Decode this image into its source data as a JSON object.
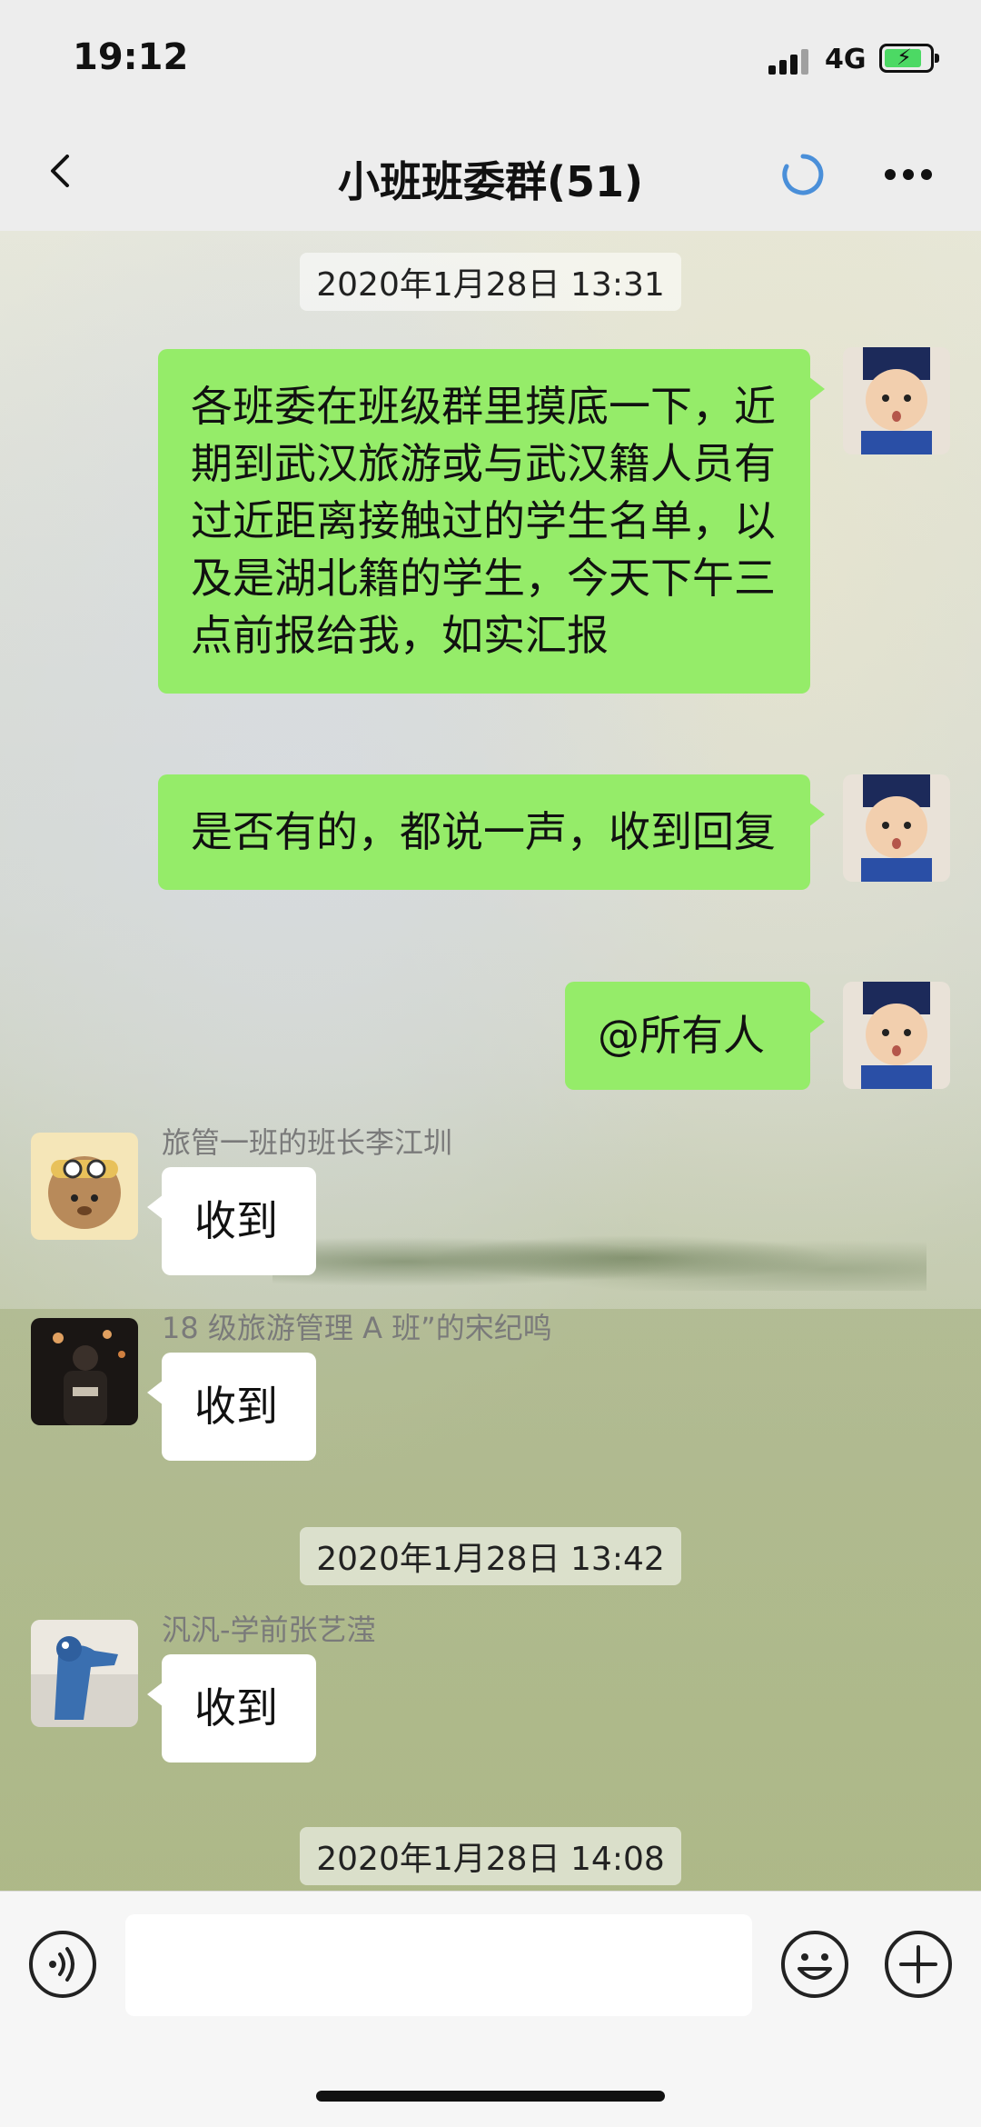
{
  "status_bar": {
    "time": "19:12",
    "network": "4G"
  },
  "nav": {
    "title": "小班班委群(51)"
  },
  "timestamps": [
    "2020年1月28日 13:31",
    "2020年1月28日 13:42",
    "2020年1月28日 14:08"
  ],
  "messages": [
    {
      "side": "out",
      "text": "各班委在班级群里摸底一下，近期到武汉旅游或与武汉籍人员有过近距离接触过的学生名单，以及是湖北籍的学生，今天下午三点前报给我，如实汇报"
    },
    {
      "side": "out",
      "text": "是否有的，都说一声，收到回复"
    },
    {
      "side": "out",
      "text": "@所有人"
    },
    {
      "side": "in",
      "sender": "旅管一班的班长李江圳",
      "text": "收到"
    },
    {
      "side": "in",
      "sender": "18 级旅游管理 A 班”的宋纪鸣",
      "text": "收到"
    },
    {
      "side": "in",
      "sender": "汎汎-学前张艺滢",
      "text": "收到"
    }
  ],
  "input": {
    "placeholder": ""
  },
  "icons": {
    "back": "back-chevron-icon",
    "sync": "sync-ring-icon",
    "more": "more-dots-icon",
    "voice": "voice-icon",
    "emoji": "emoji-icon",
    "plus": "plus-icon"
  },
  "colors": {
    "outgoing_bubble": "#95ec69",
    "incoming_bubble": "#ffffff",
    "sync_accent": "#4a8fd9"
  }
}
